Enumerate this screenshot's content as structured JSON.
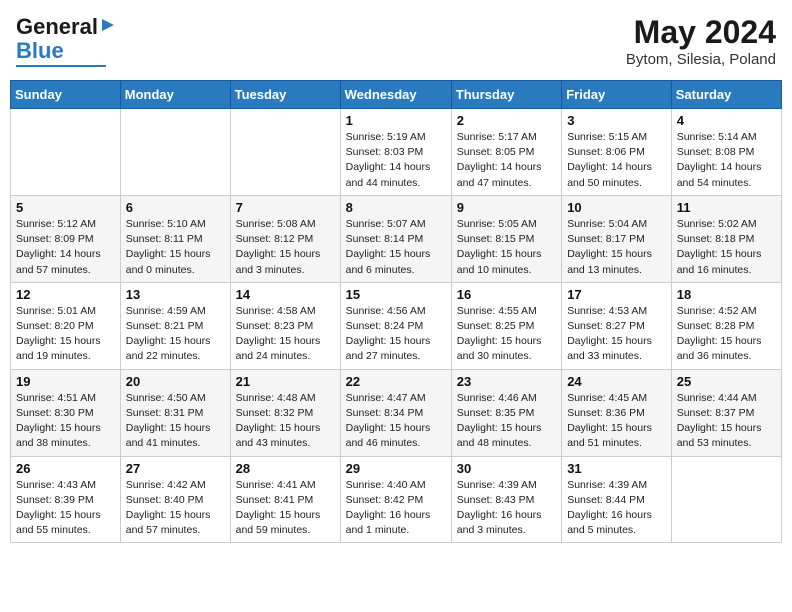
{
  "header": {
    "logo_line1": "General",
    "logo_line2": "Blue",
    "main_title": "May 2024",
    "subtitle": "Bytom, Silesia, Poland"
  },
  "weekdays": [
    "Sunday",
    "Monday",
    "Tuesday",
    "Wednesday",
    "Thursday",
    "Friday",
    "Saturday"
  ],
  "weeks": [
    [
      {
        "day": "",
        "info": ""
      },
      {
        "day": "",
        "info": ""
      },
      {
        "day": "",
        "info": ""
      },
      {
        "day": "1",
        "info": "Sunrise: 5:19 AM\nSunset: 8:03 PM\nDaylight: 14 hours\nand 44 minutes."
      },
      {
        "day": "2",
        "info": "Sunrise: 5:17 AM\nSunset: 8:05 PM\nDaylight: 14 hours\nand 47 minutes."
      },
      {
        "day": "3",
        "info": "Sunrise: 5:15 AM\nSunset: 8:06 PM\nDaylight: 14 hours\nand 50 minutes."
      },
      {
        "day": "4",
        "info": "Sunrise: 5:14 AM\nSunset: 8:08 PM\nDaylight: 14 hours\nand 54 minutes."
      }
    ],
    [
      {
        "day": "5",
        "info": "Sunrise: 5:12 AM\nSunset: 8:09 PM\nDaylight: 14 hours\nand 57 minutes."
      },
      {
        "day": "6",
        "info": "Sunrise: 5:10 AM\nSunset: 8:11 PM\nDaylight: 15 hours\nand 0 minutes."
      },
      {
        "day": "7",
        "info": "Sunrise: 5:08 AM\nSunset: 8:12 PM\nDaylight: 15 hours\nand 3 minutes."
      },
      {
        "day": "8",
        "info": "Sunrise: 5:07 AM\nSunset: 8:14 PM\nDaylight: 15 hours\nand 6 minutes."
      },
      {
        "day": "9",
        "info": "Sunrise: 5:05 AM\nSunset: 8:15 PM\nDaylight: 15 hours\nand 10 minutes."
      },
      {
        "day": "10",
        "info": "Sunrise: 5:04 AM\nSunset: 8:17 PM\nDaylight: 15 hours\nand 13 minutes."
      },
      {
        "day": "11",
        "info": "Sunrise: 5:02 AM\nSunset: 8:18 PM\nDaylight: 15 hours\nand 16 minutes."
      }
    ],
    [
      {
        "day": "12",
        "info": "Sunrise: 5:01 AM\nSunset: 8:20 PM\nDaylight: 15 hours\nand 19 minutes."
      },
      {
        "day": "13",
        "info": "Sunrise: 4:59 AM\nSunset: 8:21 PM\nDaylight: 15 hours\nand 22 minutes."
      },
      {
        "day": "14",
        "info": "Sunrise: 4:58 AM\nSunset: 8:23 PM\nDaylight: 15 hours\nand 24 minutes."
      },
      {
        "day": "15",
        "info": "Sunrise: 4:56 AM\nSunset: 8:24 PM\nDaylight: 15 hours\nand 27 minutes."
      },
      {
        "day": "16",
        "info": "Sunrise: 4:55 AM\nSunset: 8:25 PM\nDaylight: 15 hours\nand 30 minutes."
      },
      {
        "day": "17",
        "info": "Sunrise: 4:53 AM\nSunset: 8:27 PM\nDaylight: 15 hours\nand 33 minutes."
      },
      {
        "day": "18",
        "info": "Sunrise: 4:52 AM\nSunset: 8:28 PM\nDaylight: 15 hours\nand 36 minutes."
      }
    ],
    [
      {
        "day": "19",
        "info": "Sunrise: 4:51 AM\nSunset: 8:30 PM\nDaylight: 15 hours\nand 38 minutes."
      },
      {
        "day": "20",
        "info": "Sunrise: 4:50 AM\nSunset: 8:31 PM\nDaylight: 15 hours\nand 41 minutes."
      },
      {
        "day": "21",
        "info": "Sunrise: 4:48 AM\nSunset: 8:32 PM\nDaylight: 15 hours\nand 43 minutes."
      },
      {
        "day": "22",
        "info": "Sunrise: 4:47 AM\nSunset: 8:34 PM\nDaylight: 15 hours\nand 46 minutes."
      },
      {
        "day": "23",
        "info": "Sunrise: 4:46 AM\nSunset: 8:35 PM\nDaylight: 15 hours\nand 48 minutes."
      },
      {
        "day": "24",
        "info": "Sunrise: 4:45 AM\nSunset: 8:36 PM\nDaylight: 15 hours\nand 51 minutes."
      },
      {
        "day": "25",
        "info": "Sunrise: 4:44 AM\nSunset: 8:37 PM\nDaylight: 15 hours\nand 53 minutes."
      }
    ],
    [
      {
        "day": "26",
        "info": "Sunrise: 4:43 AM\nSunset: 8:39 PM\nDaylight: 15 hours\nand 55 minutes."
      },
      {
        "day": "27",
        "info": "Sunrise: 4:42 AM\nSunset: 8:40 PM\nDaylight: 15 hours\nand 57 minutes."
      },
      {
        "day": "28",
        "info": "Sunrise: 4:41 AM\nSunset: 8:41 PM\nDaylight: 15 hours\nand 59 minutes."
      },
      {
        "day": "29",
        "info": "Sunrise: 4:40 AM\nSunset: 8:42 PM\nDaylight: 16 hours\nand 1 minute."
      },
      {
        "day": "30",
        "info": "Sunrise: 4:39 AM\nSunset: 8:43 PM\nDaylight: 16 hours\nand 3 minutes."
      },
      {
        "day": "31",
        "info": "Sunrise: 4:39 AM\nSunset: 8:44 PM\nDaylight: 16 hours\nand 5 minutes."
      },
      {
        "day": "",
        "info": ""
      }
    ]
  ]
}
